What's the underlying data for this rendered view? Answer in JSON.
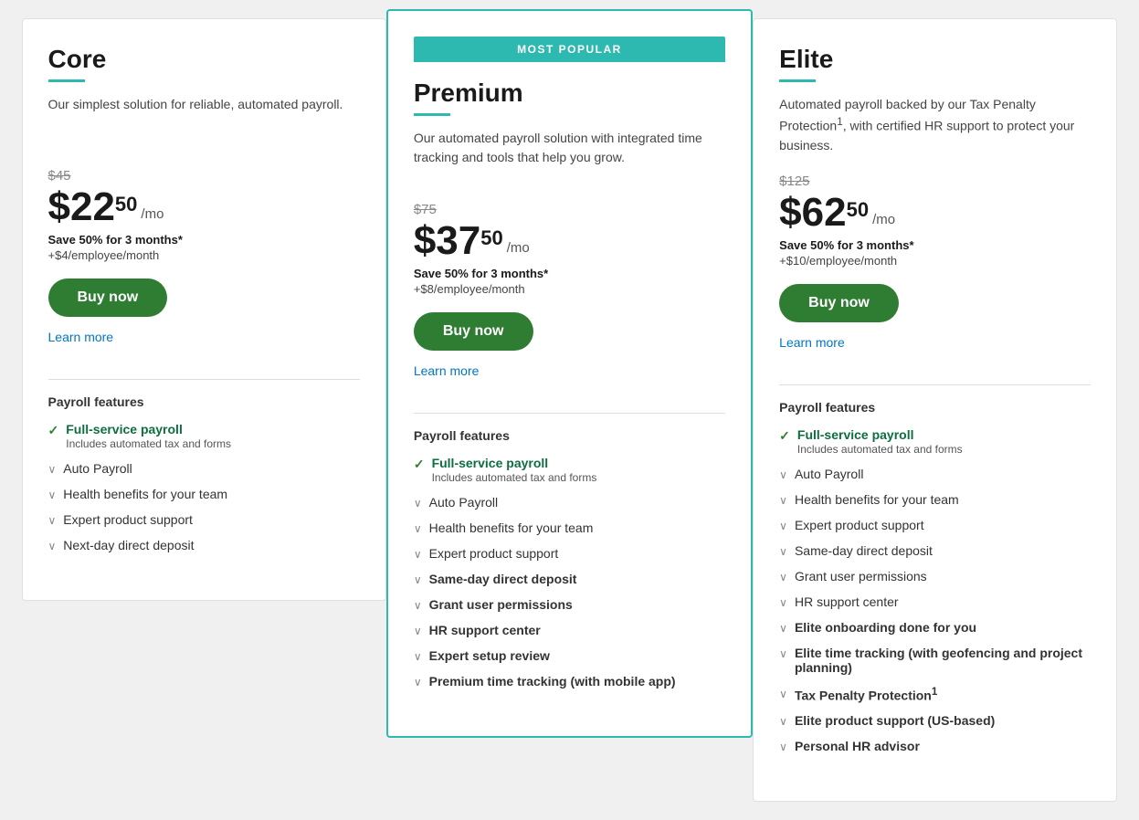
{
  "plans": [
    {
      "id": "core",
      "name": "Core",
      "description": "Our simplest solution for reliable, automated payroll.",
      "mostPopular": false,
      "originalPrice": "$45",
      "priceMain": "$22",
      "priceCents": "50",
      "pricePerMo": "/mo",
      "saveText": "Save 50% for 3 months*",
      "perEmployee": "+$4/employee/month",
      "buyNowLabel": "Buy now",
      "learnMoreLabel": "Learn more",
      "featuresHeading": "Payroll features",
      "features": [
        {
          "type": "check",
          "bold": true,
          "label": "Full-service payroll",
          "sub": "Includes automated tax and forms"
        },
        {
          "type": "chevron",
          "bold": false,
          "label": "Auto Payroll",
          "sub": ""
        },
        {
          "type": "chevron",
          "bold": false,
          "label": "Health benefits for your team",
          "sub": ""
        },
        {
          "type": "chevron",
          "bold": false,
          "label": "Expert product support",
          "sub": ""
        },
        {
          "type": "chevron",
          "bold": false,
          "label": "Next-day direct deposit",
          "sub": ""
        }
      ]
    },
    {
      "id": "premium",
      "name": "Premium",
      "description": "Our automated payroll solution with integrated time tracking and tools that help you grow.",
      "mostPopular": true,
      "mostPopularLabel": "MOST POPULAR",
      "originalPrice": "$75",
      "priceMain": "$37",
      "priceCents": "50",
      "pricePerMo": "/mo",
      "saveText": "Save 50% for 3 months*",
      "perEmployee": "+$8/employee/month",
      "buyNowLabel": "Buy now",
      "learnMoreLabel": "Learn more",
      "featuresHeading": "Payroll features",
      "features": [
        {
          "type": "check",
          "bold": true,
          "label": "Full-service payroll",
          "sub": "Includes automated tax and forms"
        },
        {
          "type": "chevron",
          "bold": false,
          "label": "Auto Payroll",
          "sub": ""
        },
        {
          "type": "chevron",
          "bold": false,
          "label": "Health benefits for your team",
          "sub": ""
        },
        {
          "type": "chevron",
          "bold": false,
          "label": "Expert product support",
          "sub": ""
        },
        {
          "type": "chevron",
          "bold": true,
          "label": "Same-day direct deposit",
          "sub": ""
        },
        {
          "type": "chevron",
          "bold": true,
          "label": "Grant user permissions",
          "sub": ""
        },
        {
          "type": "chevron",
          "bold": true,
          "label": "HR support center",
          "sub": ""
        },
        {
          "type": "chevron",
          "bold": true,
          "label": "Expert setup review",
          "sub": ""
        },
        {
          "type": "chevron",
          "bold": true,
          "label": "Premium time tracking (with mobile app)",
          "sub": ""
        }
      ]
    },
    {
      "id": "elite",
      "name": "Elite",
      "description": "Automated payroll backed by our Tax Penalty Protection",
      "descriptionSup": "1",
      "descriptionEnd": ", with certified HR support to protect your business.",
      "mostPopular": false,
      "originalPrice": "$125",
      "priceMain": "$62",
      "priceCents": "50",
      "pricePerMo": "/mo",
      "saveText": "Save 50% for 3 months*",
      "perEmployee": "+$10/employee/month",
      "buyNowLabel": "Buy now",
      "learnMoreLabel": "Learn more",
      "featuresHeading": "Payroll features",
      "features": [
        {
          "type": "check",
          "bold": true,
          "label": "Full-service payroll",
          "sub": "Includes automated tax and forms"
        },
        {
          "type": "chevron",
          "bold": false,
          "label": "Auto Payroll",
          "sub": ""
        },
        {
          "type": "chevron",
          "bold": false,
          "label": "Health benefits for your team",
          "sub": ""
        },
        {
          "type": "chevron",
          "bold": false,
          "label": "Expert product support",
          "sub": ""
        },
        {
          "type": "chevron",
          "bold": false,
          "label": "Same-day direct deposit",
          "sub": ""
        },
        {
          "type": "chevron",
          "bold": false,
          "label": "Grant user permissions",
          "sub": ""
        },
        {
          "type": "chevron",
          "bold": false,
          "label": "HR support center",
          "sub": ""
        },
        {
          "type": "chevron",
          "bold": true,
          "label": "Elite onboarding done for you",
          "sub": ""
        },
        {
          "type": "chevron",
          "bold": true,
          "label": "Elite time tracking (with geofencing and project planning)",
          "sub": ""
        },
        {
          "type": "chevron",
          "bold": true,
          "label": "Tax Penalty Protection",
          "sup": "1",
          "sub": ""
        },
        {
          "type": "chevron",
          "bold": true,
          "label": "Elite product support (US-based)",
          "sub": ""
        },
        {
          "type": "chevron",
          "bold": true,
          "label": "Personal HR advisor",
          "sub": ""
        }
      ]
    }
  ],
  "colors": {
    "teal": "#2db8b0",
    "green": "#2e7d32",
    "link": "#0077c5"
  }
}
